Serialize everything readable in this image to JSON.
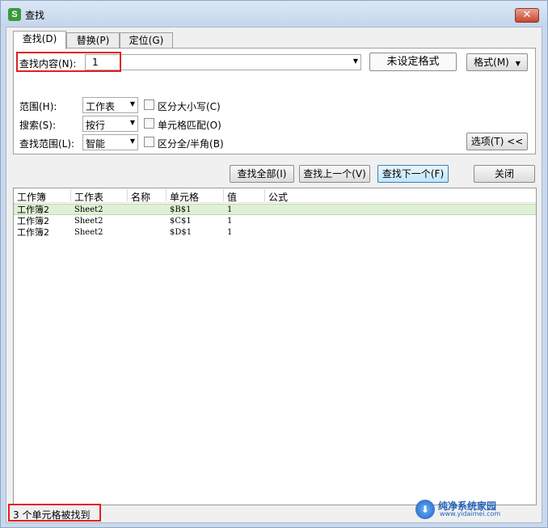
{
  "window": {
    "title": "查找",
    "app_icon_glyph": "S",
    "close_glyph": "✕"
  },
  "tabs": [
    {
      "label": "查找(D)"
    },
    {
      "label": "替换(P)"
    },
    {
      "label": "定位(G)"
    }
  ],
  "find": {
    "label": "查找内容(N):",
    "value": "1",
    "format_status": "未设定格式",
    "format_button": "格式(M)"
  },
  "options": {
    "scope_label": "范围(H):",
    "scope_value": "工作表",
    "search_label": "搜索(S):",
    "search_value": "按行",
    "lookin_label": "查找范围(L):",
    "lookin_value": "智能",
    "match_case": "区分大小写(C)",
    "match_cell": "单元格匹配(O)",
    "match_width": "区分全/半角(B)",
    "options_button": "选项(T) <<"
  },
  "actions": {
    "find_all": "查找全部(I)",
    "find_prev": "查找上一个(V)",
    "find_next": "查找下一个(F)",
    "close": "关闭"
  },
  "results": {
    "columns": [
      "工作簿",
      "工作表",
      "名称",
      "单元格",
      "值",
      "公式"
    ],
    "rows": [
      [
        "工作簿2",
        "Sheet2",
        "",
        "$B$1",
        "1",
        ""
      ],
      [
        "工作簿2",
        "Sheet2",
        "",
        "$C$1",
        "1",
        ""
      ],
      [
        "工作簿2",
        "Sheet2",
        "",
        "$D$1",
        "1",
        ""
      ]
    ]
  },
  "status": {
    "text": "3 个单元格被找到"
  },
  "watermark": {
    "text": "纯净系统家园",
    "url": "www.yidaimei.com"
  },
  "colors": {
    "highlight": "#e02020",
    "selected_row": "#dff0d4",
    "accent": "#3c7fb1"
  }
}
